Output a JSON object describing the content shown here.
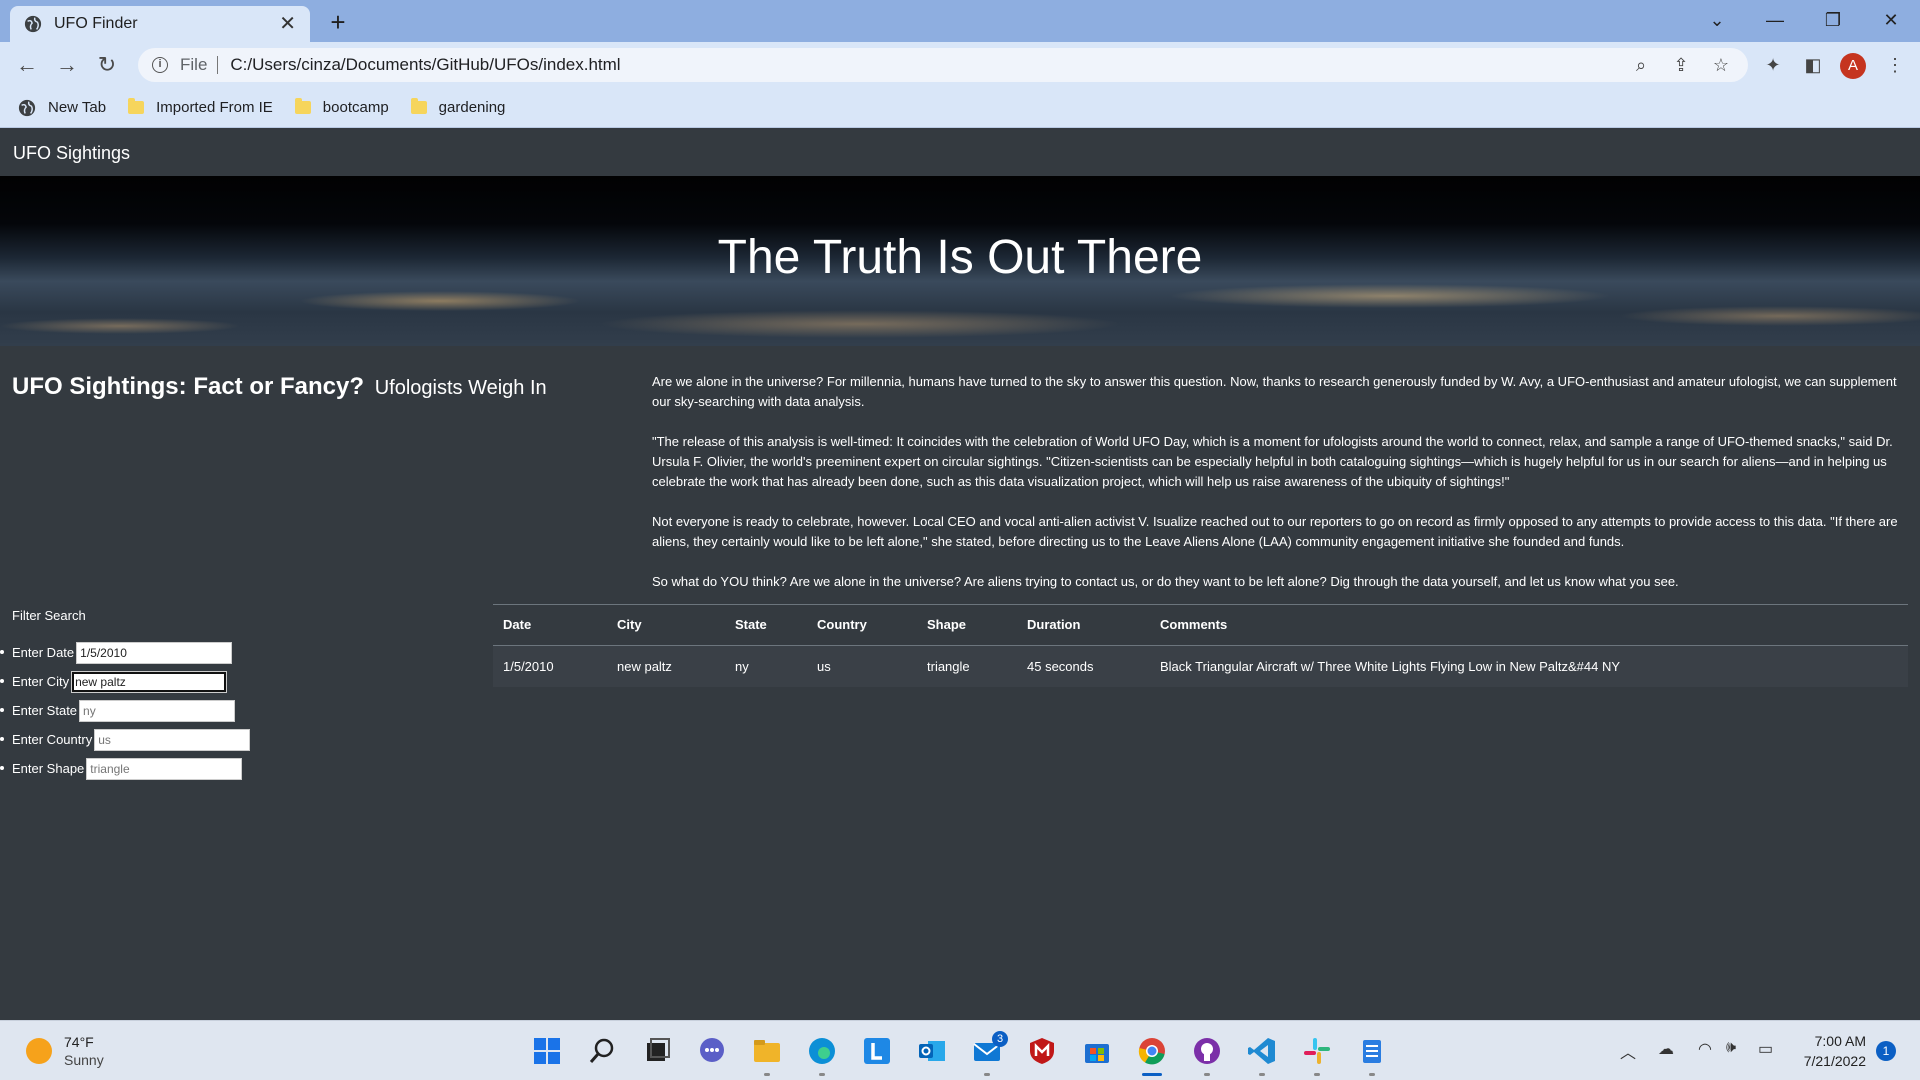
{
  "browser": {
    "tab_title": "UFO Finder",
    "address_scheme": "File",
    "address_url": "C:/Users/cinza/Documents/GitHub/UFOs/index.html",
    "profile_initial": "A",
    "bookmarks": [
      {
        "label": "New Tab",
        "icon": "globe-icon"
      },
      {
        "label": "Imported From IE",
        "icon": "folder-icon"
      },
      {
        "label": "bootcamp",
        "icon": "folder-icon"
      },
      {
        "label": "gardening",
        "icon": "folder-icon"
      }
    ]
  },
  "page": {
    "brand": "UFO Sightings",
    "hero_title": "The Truth Is Out There",
    "intro_title": "UFO Sightings: Fact or Fancy?",
    "intro_subtitle": "Ufologists Weigh In",
    "paragraphs": [
      "Are we alone in the universe? For millennia, humans have turned to the sky to answer this question. Now, thanks to research generously funded by W. Avy, a UFO-enthusiast and amateur ufologist, we can supplement our sky-searching with data analysis.",
      "\"The release of this analysis is well-timed: It coincides with the celebration of World UFO Day, which is a moment for ufologists around the world to connect, relax, and sample a range of UFO-themed snacks,\" said Dr. Ursula F. Olivier, the world's preeminent expert on circular sightings. \"Citizen-scientists can be especially helpful in both cataloguing sightings—which is hugely helpful for us in our search for aliens—and in helping us celebrate the work that has already been done, such as this data visualization project, which will help us raise awareness of the ubiquity of sightings!\"",
      "Not everyone is ready to celebrate, however. Local CEO and vocal anti-alien activist V. Isualize reached out to our reporters to go on record as firmly opposed to any attempts to provide access to this data. \"If there are aliens, they certainly would like to be left alone,\" she stated, before directing us to the Leave Aliens Alone (LAA) community engagement initiative she founded and funds.",
      "So what do YOU think? Are we alone in the universe? Are aliens trying to contact us, or do they want to be left alone? Dig through the data yourself, and let us know what you see."
    ],
    "filter_heading": "Filter Search",
    "filters": [
      {
        "label": "Enter Date",
        "value": "1/5/2010",
        "placeholder": ""
      },
      {
        "label": "Enter City",
        "value": "new paltz",
        "placeholder": ""
      },
      {
        "label": "Enter State",
        "value": "",
        "placeholder": "ny"
      },
      {
        "label": "Enter Country",
        "value": "",
        "placeholder": "us"
      },
      {
        "label": "Enter Shape",
        "value": "",
        "placeholder": "triangle"
      }
    ],
    "table": {
      "headers": [
        "Date",
        "City",
        "State",
        "Country",
        "Shape",
        "Duration",
        "Comments"
      ],
      "rows": [
        [
          "1/5/2010",
          "new paltz",
          "ny",
          "us",
          "triangle",
          "45 seconds",
          "Black Triangular Aircraft w/ Three White Lights Flying Low in New Paltz&#44 NY"
        ]
      ]
    }
  },
  "taskbar": {
    "temperature": "74°F",
    "condition": "Sunny",
    "time": "7:00 AM",
    "date": "7/21/2022",
    "notifications": "1",
    "mail_badge": "3"
  }
}
